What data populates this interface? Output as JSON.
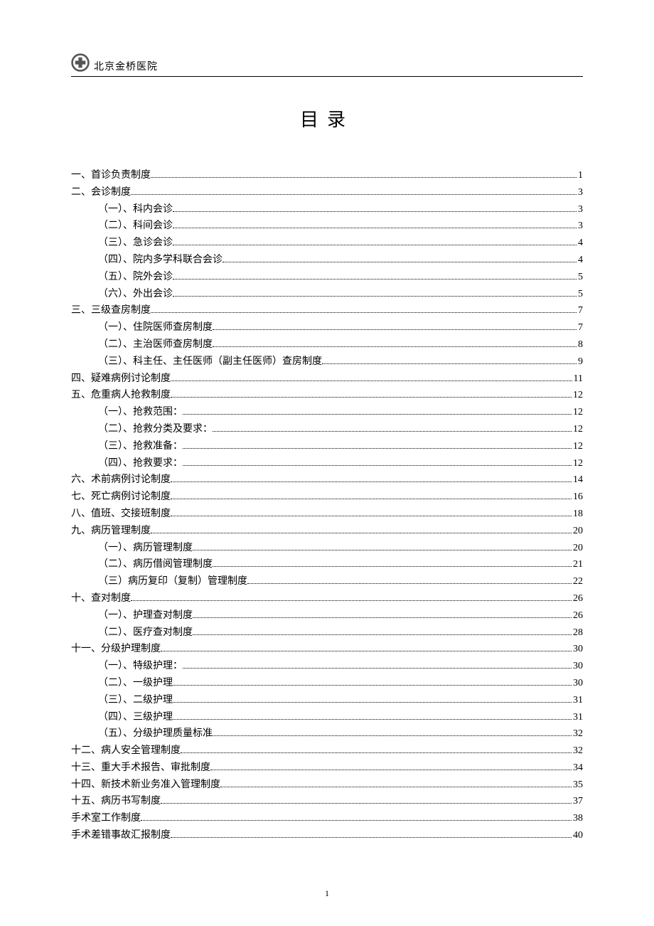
{
  "header_text": "北京金桥医院",
  "title": "目录",
  "toc": [
    {
      "label": "一、首诊负责制度",
      "page": "1",
      "indent": false
    },
    {
      "label": "二、会诊制度",
      "page": "3",
      "indent": false
    },
    {
      "label": "（一）、科内会诊",
      "page": "3",
      "indent": true
    },
    {
      "label": "（二）、科间会诊",
      "page": "3",
      "indent": true
    },
    {
      "label": "（三）、急诊会诊",
      "page": "4",
      "indent": true
    },
    {
      "label": "（四）、院内多学科联合会诊",
      "page": "4",
      "indent": true
    },
    {
      "label": "（五）、院外会诊",
      "page": "5",
      "indent": true
    },
    {
      "label": "（六）、外出会诊",
      "page": "5",
      "indent": true
    },
    {
      "label": "三、三级查房制度",
      "page": "7",
      "indent": false
    },
    {
      "label": "（一）、住院医师查房制度",
      "page": "7",
      "indent": true
    },
    {
      "label": "（二）、主治医师查房制度",
      "page": "8",
      "indent": true
    },
    {
      "label": "（三）、科主任、主任医师（副主任医师）查房制度",
      "page": "9",
      "indent": true
    },
    {
      "label": "四、疑难病例讨论制度",
      "page": "11",
      "indent": false
    },
    {
      "label": "五、危重病人抢救制度",
      "page": "12",
      "indent": false
    },
    {
      "label": "（一）、抢救范围：",
      "page": "12",
      "indent": true
    },
    {
      "label": "（二）、抢救分类及要求：",
      "page": "12",
      "indent": true
    },
    {
      "label": "（三）、抢救准备：",
      "page": "12",
      "indent": true
    },
    {
      "label": "（四）、抢救要求：",
      "page": "12",
      "indent": true
    },
    {
      "label": "六、术前病例讨论制度",
      "page": "14",
      "indent": false
    },
    {
      "label": "七、死亡病例讨论制度",
      "page": "16",
      "indent": false
    },
    {
      "label": "八、值班、交接班制度",
      "page": "18",
      "indent": false
    },
    {
      "label": "九、病历管理制度",
      "page": "20",
      "indent": false
    },
    {
      "label": "（一）、病历管理制度",
      "page": "20",
      "indent": true
    },
    {
      "label": "（二）、病历借阅管理制度",
      "page": "21",
      "indent": true
    },
    {
      "label": "（三）病历复印（复制）管理制度",
      "page": "22",
      "indent": true
    },
    {
      "label": "十、查对制度",
      "page": "26",
      "indent": false
    },
    {
      "label": "（一）、护理查对制度",
      "page": "26",
      "indent": true
    },
    {
      "label": "（二）、医疗查对制度",
      "page": "28",
      "indent": true
    },
    {
      "label": "十一、分级护理制度",
      "page": "30",
      "indent": false
    },
    {
      "label": "（一）、特级护理：",
      "page": "30",
      "indent": true
    },
    {
      "label": "（二）、一级护理",
      "page": "30",
      "indent": true
    },
    {
      "label": "（三）、二级护理",
      "page": "31",
      "indent": true
    },
    {
      "label": "（四）、三级护理",
      "page": "31",
      "indent": true
    },
    {
      "label": "（五）、分级护理质量标准",
      "page": "32",
      "indent": true
    },
    {
      "label": "十二、病人安全管理制度",
      "page": "32",
      "indent": false
    },
    {
      "label": "十三、重大手术报告、审批制度",
      "page": "34",
      "indent": false
    },
    {
      "label": "十四、新技术新业务准入管理制度",
      "page": "35",
      "indent": false
    },
    {
      "label": "十五、病历书写制度",
      "page": "37",
      "indent": false
    },
    {
      "label": "手术室工作制度",
      "page": "38",
      "indent": false
    },
    {
      "label": "手术差错事故汇报制度",
      "page": "40",
      "indent": false
    }
  ],
  "page_number": "1"
}
